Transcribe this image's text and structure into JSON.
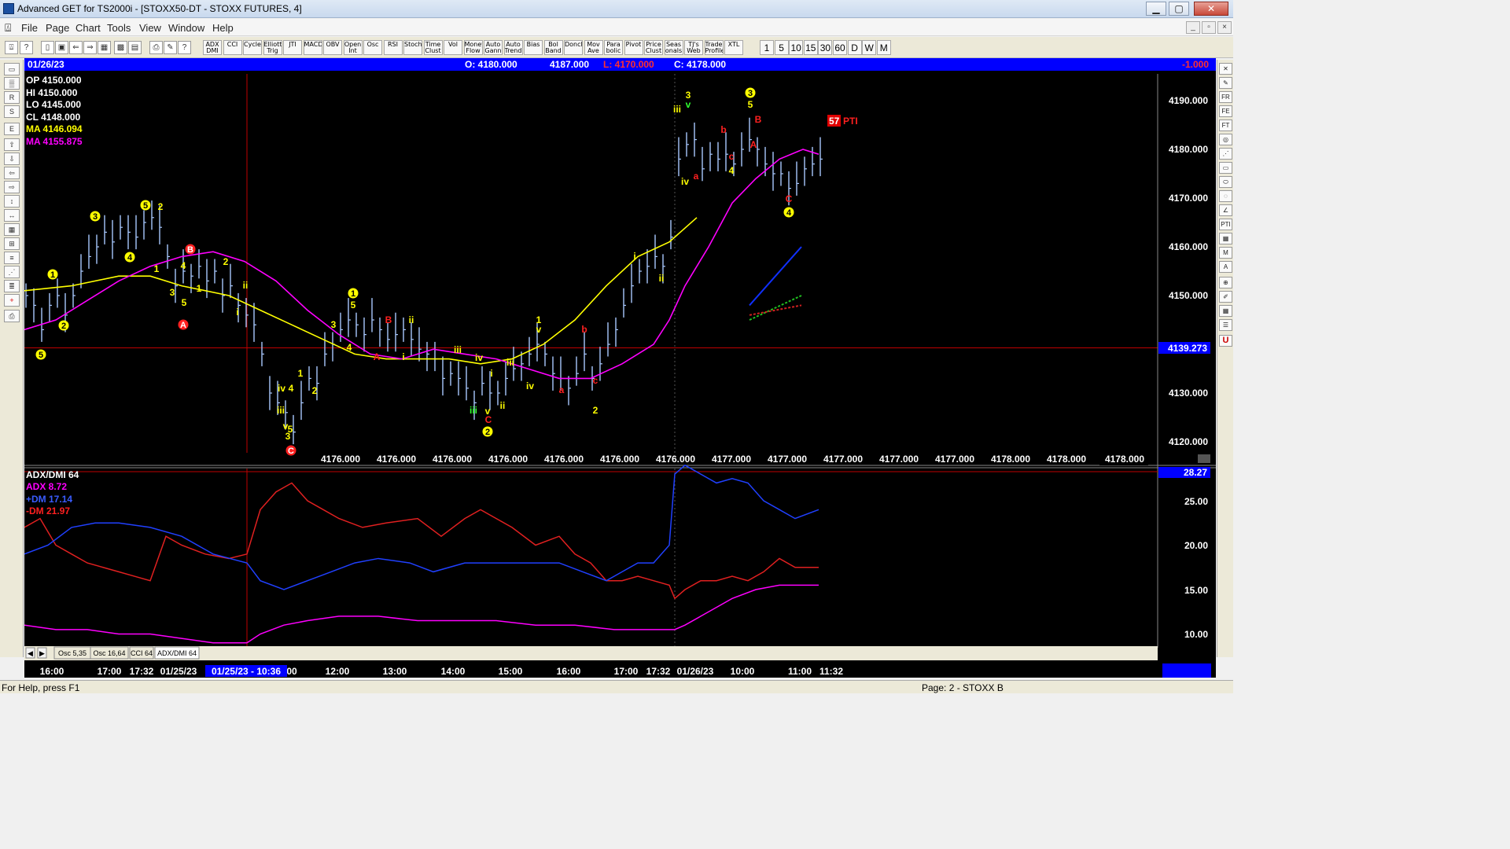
{
  "window": {
    "title": "Advanced GET for TS2000i - [STOXX50-DT - STOXX FUTURES, 4]",
    "min": "▁",
    "max": "▢",
    "close": "✕"
  },
  "menu": [
    "File",
    "Page",
    "Chart",
    "Tools",
    "View",
    "Window",
    "Help"
  ],
  "toolbar": {
    "studies": [
      "ADX DMI",
      "CCI",
      "Cycles",
      "Elliott Trig",
      "JTI",
      "MACD",
      "OBV",
      "Open Int",
      "Osc",
      "RSI",
      "Stoch",
      "Time Clust",
      "Vol",
      "Money Flow",
      "Auto Gann",
      "Auto Trend",
      "Bias",
      "Bol Band",
      "Donch",
      "Mov Ave",
      "Para bolic",
      "Pivot",
      "Price Clust",
      "Seas onals",
      "TJ's Web",
      "Trade Profile",
      "XTL"
    ],
    "intervals": [
      "1",
      "5",
      "10",
      "15",
      "30",
      "60",
      "D",
      "W",
      "M"
    ]
  },
  "header": {
    "date": "01/26/23",
    "open": "O: 4180.000",
    "high": "4187.000",
    "low": "L: 4170.000",
    "close": "C: 4178.000",
    "change": "-1.000"
  },
  "info": {
    "op": "OP  4150.000",
    "hi": "HI   4150.000",
    "lo": "LO  4145.000",
    "cl": "CL  4148.000",
    "ma1": "MA  4146.094",
    "ma2": "MA  4155.875"
  },
  "pti": {
    "value": "57",
    "label": "PTI"
  },
  "price_axis": [
    "4190.000",
    "4180.000",
    "4170.000",
    "4160.000",
    "4150.000",
    "4130.000",
    "4120.000"
  ],
  "price_marker": "4139.273",
  "bottom_values": [
    "4176.000",
    "4176.000",
    "4176.000",
    "4176.000",
    "4176.000",
    "4176.000",
    "4176.000",
    "4177.000",
    "4177.000",
    "4177.000",
    "4177.000",
    "4177.000",
    "4178.000",
    "4178.000"
  ],
  "bottom_last": "4178.000",
  "adx": {
    "title": "ADX/DMI 64",
    "adx": "ADX 8.72",
    "pdm": "+DM 17.14",
    "mdm": "-DM  21.97",
    "marker": "28.27",
    "axis": [
      "25.00",
      "20.00",
      "15.00",
      "10.00"
    ]
  },
  "tabs": [
    "Osc 5,35",
    "Osc 16,64",
    "CCI 64",
    "ADX/DMI 64"
  ],
  "time_axis": [
    "16:00",
    "17:00",
    "17:32",
    "01/25/23",
    "00",
    "12:00",
    "13:00",
    "14:00",
    "15:00",
    "16:00",
    "17:00",
    "17:32",
    "01/26/23",
    "10:00",
    "11:00",
    "11:32"
  ],
  "cursor_time": "01/25/23 - 10:36",
  "wave_labels": [
    {
      "t": "5",
      "c": "yellow",
      "circ": true
    },
    {
      "t": "2",
      "c": "yellow",
      "circ": true
    },
    {
      "t": "1",
      "c": "yellow",
      "circ": true
    },
    {
      "t": "3",
      "c": "yellow",
      "circ": true
    },
    {
      "t": "4",
      "c": "yellow",
      "circ": true
    },
    {
      "t": "5",
      "c": "yellow",
      "circ": true
    },
    {
      "t": "2",
      "c": "yellow",
      "circ": false
    },
    {
      "t": "1",
      "c": "yellow",
      "circ": false
    },
    {
      "t": "3",
      "c": "yellow",
      "circ": false
    },
    {
      "t": "B",
      "c": "red",
      "circ": true
    },
    {
      "t": "4",
      "c": "yellow",
      "circ": false
    },
    {
      "t": "5",
      "c": "yellow",
      "circ": false
    },
    {
      "t": "1",
      "c": "yellow",
      "circ": false
    },
    {
      "t": "2",
      "c": "yellow",
      "circ": false
    },
    {
      "t": "A",
      "c": "red",
      "circ": true
    },
    {
      "t": "ii",
      "c": "yellow",
      "circ": false
    },
    {
      "t": "i",
      "c": "yellow",
      "circ": false
    },
    {
      "t": "iv",
      "c": "yellow",
      "circ": false
    },
    {
      "t": "4",
      "c": "yellow",
      "circ": false
    },
    {
      "t": "iii",
      "c": "yellow",
      "circ": false
    },
    {
      "t": "v",
      "c": "yellow",
      "circ": false
    },
    {
      "t": "5",
      "c": "yellow",
      "circ": false
    },
    {
      "t": "3",
      "c": "yellow",
      "circ": false
    },
    {
      "t": "C",
      "c": "red",
      "circ": true
    },
    {
      "t": "1",
      "c": "yellow",
      "circ": false
    },
    {
      "t": "2",
      "c": "yellow",
      "circ": false
    },
    {
      "t": "1",
      "c": "yellow",
      "circ": true
    },
    {
      "t": "5",
      "c": "yellow",
      "circ": false
    },
    {
      "t": "3",
      "c": "yellow",
      "circ": false
    },
    {
      "t": "4",
      "c": "yellow",
      "circ": false
    },
    {
      "t": "B",
      "c": "red",
      "circ": false
    },
    {
      "t": "ii",
      "c": "yellow",
      "circ": false
    },
    {
      "t": "A",
      "c": "red",
      "circ": false
    },
    {
      "t": "i",
      "c": "yellow",
      "circ": false
    },
    {
      "t": "iv",
      "c": "yellow",
      "circ": false
    },
    {
      "t": "iii",
      "c": "yellow",
      "circ": false
    },
    {
      "t": "i",
      "c": "yellow",
      "circ": false
    },
    {
      "t": "iii",
      "c": "lime",
      "circ": false
    },
    {
      "t": "v",
      "c": "yellow",
      "circ": false
    },
    {
      "t": "C",
      "c": "red",
      "circ": false
    },
    {
      "t": "ii",
      "c": "yellow",
      "circ": false
    },
    {
      "t": "2",
      "c": "yellow",
      "circ": true
    },
    {
      "t": "iii",
      "c": "yellow",
      "circ": false
    },
    {
      "t": "iv",
      "c": "yellow",
      "circ": false
    },
    {
      "t": "1",
      "c": "yellow",
      "circ": false
    },
    {
      "t": "v",
      "c": "yellow",
      "circ": false
    },
    {
      "t": "a",
      "c": "red",
      "circ": false
    },
    {
      "t": "b",
      "c": "red",
      "circ": false
    },
    {
      "t": "c",
      "c": "red",
      "circ": false
    },
    {
      "t": "2",
      "c": "yellow",
      "circ": false
    },
    {
      "t": "i",
      "c": "yellow",
      "circ": false
    },
    {
      "t": "ii",
      "c": "yellow",
      "circ": false
    },
    {
      "t": "iii",
      "c": "yellow",
      "circ": false
    },
    {
      "t": "3",
      "c": "yellow",
      "circ": false
    },
    {
      "t": "v",
      "c": "lime",
      "circ": false
    },
    {
      "t": "iv",
      "c": "yellow",
      "circ": false
    },
    {
      "t": "a",
      "c": "red",
      "circ": false
    },
    {
      "t": "b",
      "c": "red",
      "circ": false
    },
    {
      "t": "c",
      "c": "red",
      "circ": false
    },
    {
      "t": "4",
      "c": "yellow",
      "circ": false
    },
    {
      "t": "3",
      "c": "yellow",
      "circ": true
    },
    {
      "t": "5",
      "c": "yellow",
      "circ": false
    },
    {
      "t": "B",
      "c": "red",
      "circ": false
    },
    {
      "t": "A",
      "c": "red",
      "circ": false
    },
    {
      "t": "C",
      "c": "red",
      "circ": false
    },
    {
      "t": "4",
      "c": "yellow",
      "circ": true
    }
  ],
  "status": {
    "left": "For Help, press F1",
    "right": "Page: 2 - STOXX B"
  },
  "colors": {
    "bg": "#000000",
    "price": "#a8c8ff",
    "ma_fast": "#ffff00",
    "ma_slow": "#ff00ff",
    "marker": "#0000ff",
    "header": "#0000ff"
  }
}
